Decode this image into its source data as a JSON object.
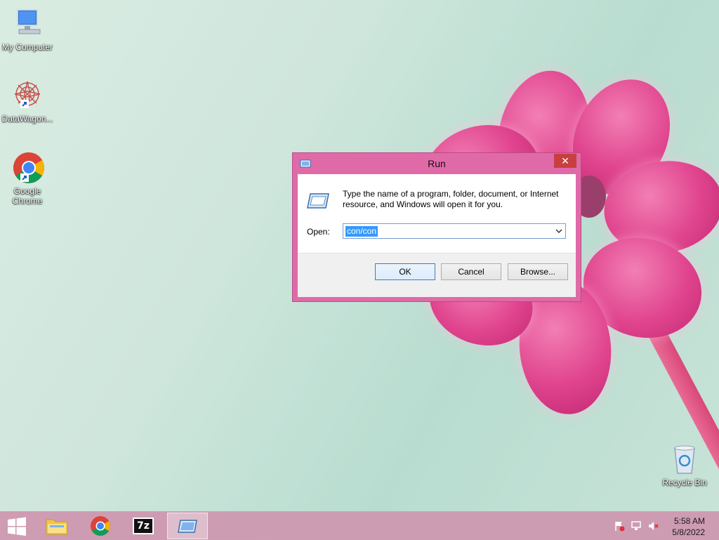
{
  "desktop": {
    "icons": [
      {
        "label": "My Computer"
      },
      {
        "label": "DataWagon..."
      },
      {
        "label": "Google Chrome"
      },
      {
        "label": "Recycle Bin"
      }
    ]
  },
  "dialog": {
    "title": "Run",
    "close_glyph": "✕",
    "description": "Type the name of a program, folder, document, or Internet resource, and Windows will open it for you.",
    "open_label": "Open:",
    "open_value": "con/con",
    "buttons": {
      "ok": "OK",
      "cancel": "Cancel",
      "browse": "Browse..."
    }
  },
  "taskbar": {
    "apps": [
      "start-button",
      "file-explorer",
      "google-chrome",
      "7-zip",
      "run-dialog"
    ],
    "sevenzip_label": "7z",
    "clock": {
      "time": "5:58 AM",
      "date": "5/8/2022"
    }
  },
  "colors": {
    "accent": "#e06aa8",
    "close": "#c7403f",
    "selection": "#3399ff"
  }
}
